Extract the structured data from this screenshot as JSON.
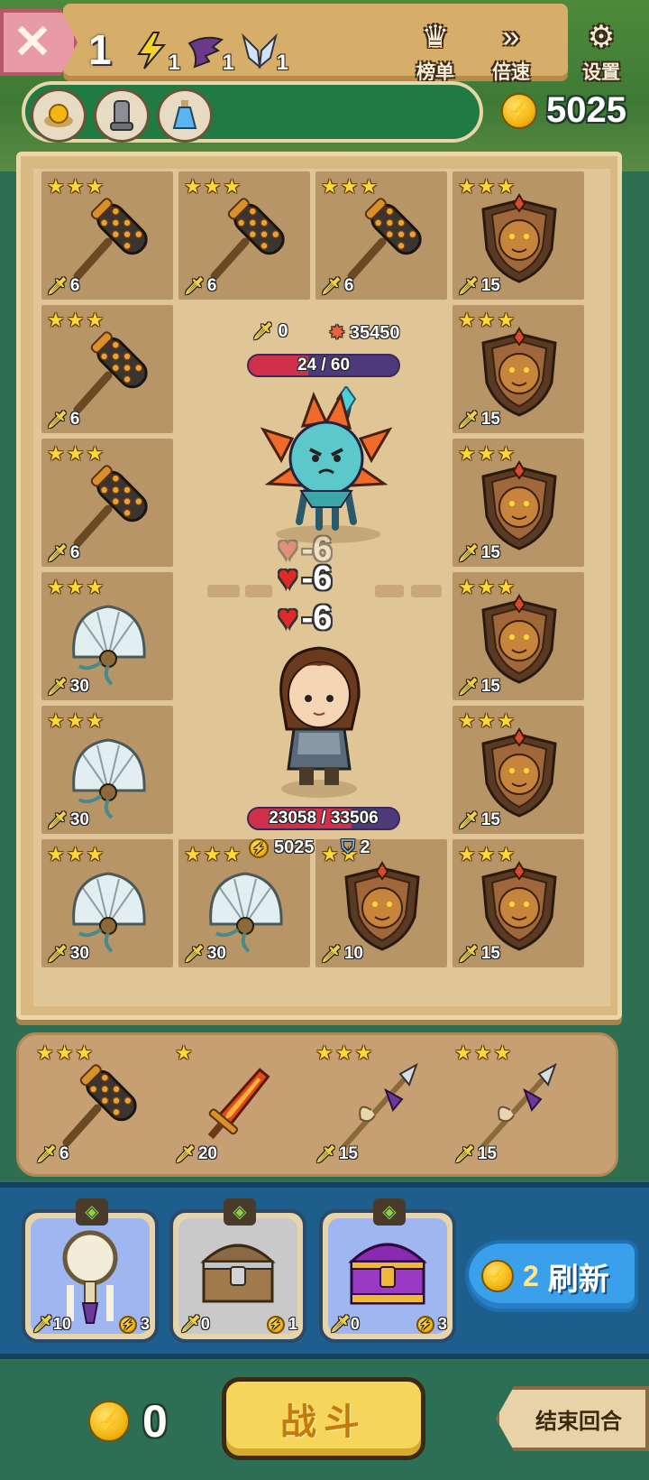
{
  "header": {
    "close_icon": "close-x",
    "level": "1",
    "stats": [
      {
        "icon": "lightning-icon",
        "count": "1",
        "color": "#f5d32a"
      },
      {
        "icon": "bat-wing-icon",
        "count": "1",
        "color": "#6a3a8a"
      },
      {
        "icon": "angel-wing-icon",
        "count": "1",
        "color": "#cfe4f4"
      }
    ],
    "menu": [
      {
        "icon": "crown-icon",
        "label": "榜单"
      },
      {
        "icon": "fast-forward-icon",
        "label": "倍速"
      },
      {
        "icon": "gear-icon",
        "label": "设置"
      }
    ],
    "relics": [
      "golden-orb-relic-icon",
      "iron-greave-relic-icon",
      "blue-potion-relic-icon"
    ],
    "gold": "5025"
  },
  "board": {
    "slots": [
      {
        "item": "spiked-club",
        "stars": "★★★",
        "power": "6"
      },
      {
        "item": "spiked-club",
        "stars": "★★★",
        "power": "6"
      },
      {
        "item": "spiked-club",
        "stars": "★★★",
        "power": "6"
      },
      {
        "item": "lion-shield",
        "stars": "★★★",
        "power": "15"
      },
      {
        "item": "spiked-club",
        "stars": "★★★",
        "power": "6"
      },
      {
        "item": "lion-shield",
        "stars": "★★★",
        "power": "15"
      },
      {
        "item": "spiked-club",
        "stars": "★★★",
        "power": "6"
      },
      {
        "item": "lion-shield",
        "stars": "★★★",
        "power": "15"
      },
      {
        "item": "bone-fan",
        "stars": "★★★",
        "power": "30"
      },
      {
        "item": "lion-shield",
        "stars": "★★★",
        "power": "15"
      },
      {
        "item": "bone-fan",
        "stars": "★★★",
        "power": "30"
      },
      {
        "item": "lion-shield",
        "stars": "★★★",
        "power": "15"
      },
      {
        "item": "bone-fan",
        "stars": "★★★",
        "power": "30"
      },
      {
        "item": "bone-fan",
        "stars": "★★★",
        "power": "30"
      },
      {
        "item": "lion-shield",
        "stars": "★★",
        "power": "10"
      },
      {
        "item": "lion-shield",
        "stars": "★★★",
        "power": "15"
      }
    ]
  },
  "battle": {
    "enemy": {
      "attack": "0",
      "score": "35450",
      "hp_text": "24 / 60",
      "hp_fraction": 0.4
    },
    "damage_popups": [
      "-6",
      "-6",
      "-6"
    ],
    "hero": {
      "hp_text": "23058 / 33506",
      "hp_fraction": 0.688,
      "gold": "5025",
      "armor": "2"
    }
  },
  "hand": [
    {
      "item": "spiked-club",
      "stars": "★★★",
      "power": "6"
    },
    {
      "item": "flame-sword",
      "stars": "★",
      "power": "20"
    },
    {
      "item": "feather-spear",
      "stars": "★★★",
      "power": "15"
    },
    {
      "item": "feather-spear",
      "stars": "★★★",
      "power": "15"
    }
  ],
  "shop": {
    "cards": [
      {
        "item": "mirror-totem",
        "power": "10",
        "cost": "3",
        "bg": "#9fb6f0",
        "badge": "bat-wing-icon"
      },
      {
        "item": "wooden-chest",
        "power": "0",
        "cost": "1",
        "bg": "#c9c9c9",
        "badge": "knot-icon"
      },
      {
        "item": "purple-chest",
        "power": "0",
        "cost": "3",
        "bg": "#9fb6f0",
        "badge": "knot-icon"
      }
    ],
    "refresh": {
      "cost": "2",
      "label": "刷新"
    }
  },
  "footer": {
    "gold": "0",
    "fight_label": "战斗",
    "end_turn_label": "结束回合"
  },
  "colors": {
    "hp_red": "#d0304a",
    "hp_track": "#4c3a7a",
    "gold": "#f3b612",
    "shop_blue": "#1e5e8c"
  }
}
